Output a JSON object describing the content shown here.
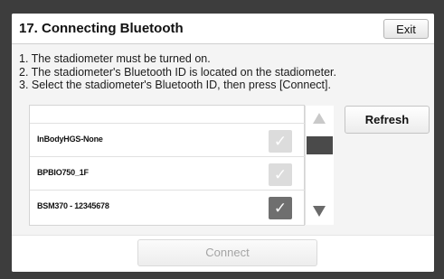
{
  "dialog": {
    "title": "17. Connecting Bluetooth",
    "exit_label": "Exit"
  },
  "instructions": [
    "1. The stadiometer must be turned on.",
    "2. The stadiometer's Bluetooth ID is located on the stadiometer.",
    "3. Select the stadiometer's Bluetooth ID, then press [Connect]."
  ],
  "device_list": {
    "items": [
      {
        "label": "InBodyHGS-None",
        "selected": false,
        "check_icon": "check-icon"
      },
      {
        "label": "BPBIO750_1F",
        "selected": false,
        "check_icon": "check-icon"
      },
      {
        "label": "BSM370 - 12345678",
        "selected": true,
        "check_icon": "check-icon"
      }
    ],
    "check_glyph": "✓"
  },
  "buttons": {
    "refresh_label": "Refresh",
    "connect_label": "Connect"
  },
  "colors": {
    "selected_check": "#6f6f6f",
    "unselected_check": "#dcdcdc",
    "scroll_thumb": "#4a4a4a",
    "disabled_text": "#a4a4a4"
  }
}
